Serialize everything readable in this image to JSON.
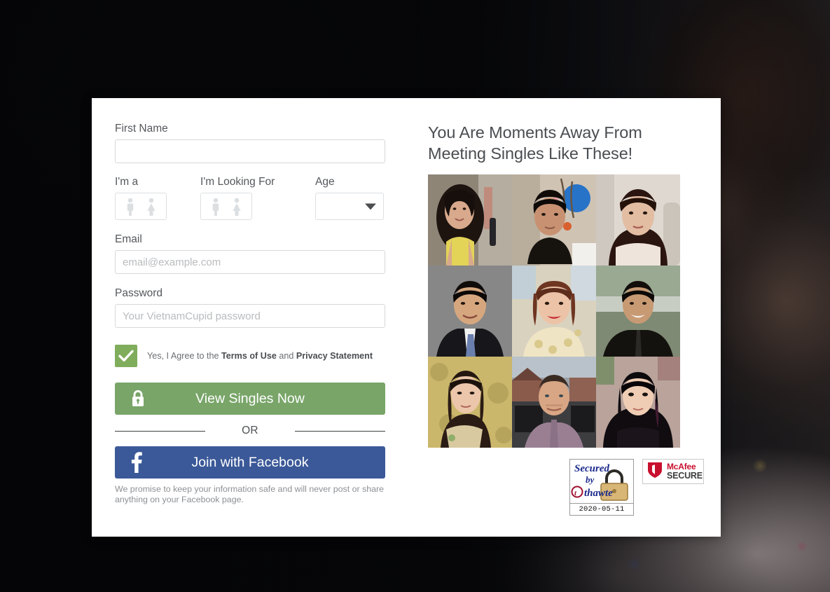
{
  "background": {
    "description": "darkened portrait photo backdrop",
    "overlay_color": "#050507"
  },
  "form": {
    "first_name": {
      "label": "First Name",
      "value": "",
      "placeholder": ""
    },
    "im_a": {
      "label": "I'm a",
      "options": [
        "male",
        "female"
      ],
      "selected": ""
    },
    "im_looking_for": {
      "label": "I'm Looking For",
      "options": [
        "male",
        "female"
      ],
      "selected": ""
    },
    "age": {
      "label": "Age",
      "value": "",
      "caret_icon": "chevron-down-icon"
    },
    "email": {
      "label": "Email",
      "value": "",
      "placeholder": "email@example.com"
    },
    "password": {
      "label": "Password",
      "value": "",
      "placeholder": "Your VietnamCupid password"
    },
    "agree": {
      "checked": true,
      "prefix": "Yes, I Agree to the ",
      "terms_link": "Terms of Use",
      "middle": " and ",
      "privacy_link": "Privacy Statement",
      "check_color": "#7fad5b"
    },
    "submit_button": {
      "label": "View Singles Now",
      "icon": "lock-icon",
      "color": "#79a569"
    },
    "divider_text": "OR",
    "facebook_button": {
      "label": "Join with Facebook",
      "icon": "facebook-f-icon",
      "color": "#3b5998"
    },
    "promise_text": "We promise to keep your information safe and will never post or share anything on your Facebook page."
  },
  "promo": {
    "heading": "You Are Moments Away From Meeting Singles Like These!",
    "photos": [
      {
        "alt": "asian-woman-yellow-top-selfie",
        "skin": "#d8a98c",
        "hair": "#1d1410",
        "bg": "#9c9387",
        "top": "#e3d357"
      },
      {
        "alt": "asian-man-black-jacket-flowers",
        "skin": "#c89272",
        "hair": "#150f0c",
        "bg": "#cfc3b4",
        "top": "#1a1614"
      },
      {
        "alt": "asian-woman-long-hair-car",
        "skin": "#e3bda2",
        "hair": "#2a1510",
        "bg": "#ddd6ce",
        "top": "#e8ded6"
      },
      {
        "alt": "asian-man-suit-blue-tie-studio",
        "skin": "#d6a77f",
        "hair": "#100c09",
        "bg": "#8d8d8d",
        "top": "#17161a"
      },
      {
        "alt": "asian-woman-floral-dress-smiling",
        "skin": "#ecc3a6",
        "hair": "#6e3521",
        "bg": "#d9d2bf",
        "top": "#efe4c4"
      },
      {
        "alt": "asian-man-black-jacket-outdoors",
        "skin": "#c79a74",
        "hair": "#120e0b",
        "bg": "#7e8a74",
        "top": "#14120f"
      },
      {
        "alt": "asian-woman-pale-gold-curtain",
        "skin": "#ecc6ab",
        "hair": "#2a1b14",
        "bg": "#c6b268",
        "top": "#d9c9a0"
      },
      {
        "alt": "western-man-purple-shirt-driveway",
        "skin": "#d8a684",
        "hair": "#3a2b22",
        "bg": "#8b9099",
        "top": "#9a7f93"
      },
      {
        "alt": "asian-woman-dark-long-hair-portrait",
        "skin": "#efcdb4",
        "hair": "#100c10",
        "bg": "#b9a39b",
        "top": "#1b141a"
      }
    ]
  },
  "badges": {
    "thawte": {
      "line1": "Secured",
      "line2": "by",
      "brand": "thawte",
      "date": "2020-05-11",
      "icon": "padlock-icon"
    },
    "mcafee": {
      "line1": "McAfee",
      "line2": "SECURE",
      "tm": "™",
      "icon": "mcafee-shield-icon",
      "color": "#c8102e"
    }
  }
}
